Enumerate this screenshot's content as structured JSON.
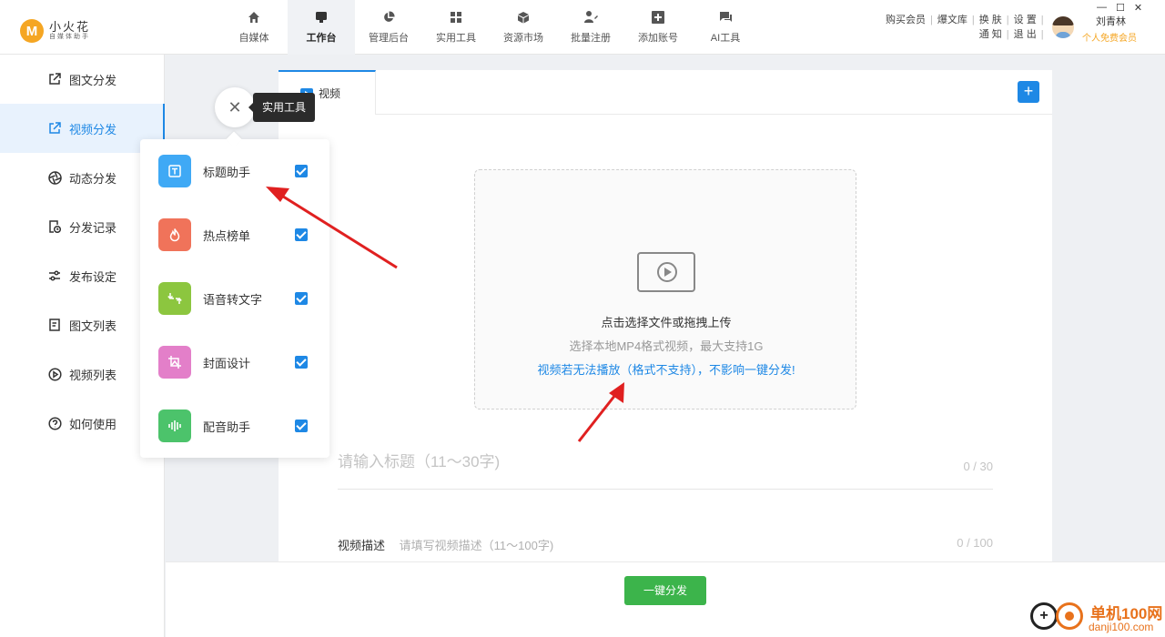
{
  "app": {
    "logo_letter": "M",
    "name": "小火花",
    "subtitle": "自媒体助手"
  },
  "nav": [
    {
      "label": "自媒体",
      "icon": "home-icon"
    },
    {
      "label": "工作台",
      "icon": "workbench-icon",
      "active": true
    },
    {
      "label": "管理后台",
      "icon": "pie-chart-icon"
    },
    {
      "label": "实用工具",
      "icon": "grid-icon"
    },
    {
      "label": "资源市场",
      "icon": "cube-icon"
    },
    {
      "label": "批量注册",
      "icon": "user-edit-icon"
    },
    {
      "label": "添加账号",
      "icon": "plus-square-icon"
    },
    {
      "label": "AI工具",
      "icon": "chat-icon"
    }
  ],
  "toplinks": {
    "buy_member": "购买会员",
    "baowenku": "爆文库",
    "skin": "换 肤",
    "settings": "设 置",
    "notice": "通 知",
    "logout": "退 出"
  },
  "user": {
    "name": "刘青林",
    "level": "个人免费会员"
  },
  "sidebar": [
    {
      "label": "图文分发",
      "icon": "external-link-icon"
    },
    {
      "label": "视频分发",
      "icon": "video-share-icon",
      "active": true
    },
    {
      "label": "动态分发",
      "icon": "aperture-icon"
    },
    {
      "label": "分发记录",
      "icon": "record-icon"
    },
    {
      "label": "发布设定",
      "icon": "sliders-icon"
    },
    {
      "label": "图文列表",
      "icon": "list-doc-icon"
    },
    {
      "label": "视频列表",
      "icon": "play-circle-icon"
    },
    {
      "label": "如何使用",
      "icon": "question-icon"
    }
  ],
  "tab": {
    "label": "视频",
    "add": "+"
  },
  "upload": {
    "line1": "点击选择文件或拖拽上传",
    "line2": "选择本地MP4格式视频，最大支持1G",
    "line3": "视频若无法播放（格式不支持），不影响一键分发!"
  },
  "form": {
    "title_placeholder": "请输入标题（11～30字)",
    "title_count": "0 / 30",
    "desc_label": "视频描述",
    "desc_placeholder": "请填写视频描述（11～100字)",
    "desc_count": "0 / 100"
  },
  "publish_label": "一键分发",
  "popup": {
    "close": "✕",
    "tooltip": "实用工具",
    "tools": [
      {
        "label": "标题助手",
        "color": "#3fa9f5",
        "icon": "text-box-icon",
        "checked": true
      },
      {
        "label": "热点榜单",
        "color": "#f0735a",
        "icon": "flame-icon",
        "checked": true
      },
      {
        "label": "语音转文字",
        "color": "#8cc63f",
        "icon": "translate-icon",
        "checked": true
      },
      {
        "label": "封面设计",
        "color": "#e37fc9",
        "icon": "image-icon",
        "checked": true
      },
      {
        "label": "配音助手",
        "color": "#4cc36b",
        "icon": "soundwave-icon",
        "checked": true
      }
    ]
  },
  "watermark": {
    "logo_glyph": "+",
    "line1": "单机100网",
    "line2": "danji100.com"
  },
  "window": {
    "minimize": "—",
    "maximize": "☐",
    "close": "✕"
  },
  "colors": {
    "accent": "#1e88e5",
    "publish": "#3cb44b",
    "logo": "#f5a623",
    "annotation_arrow": "#e02020"
  }
}
